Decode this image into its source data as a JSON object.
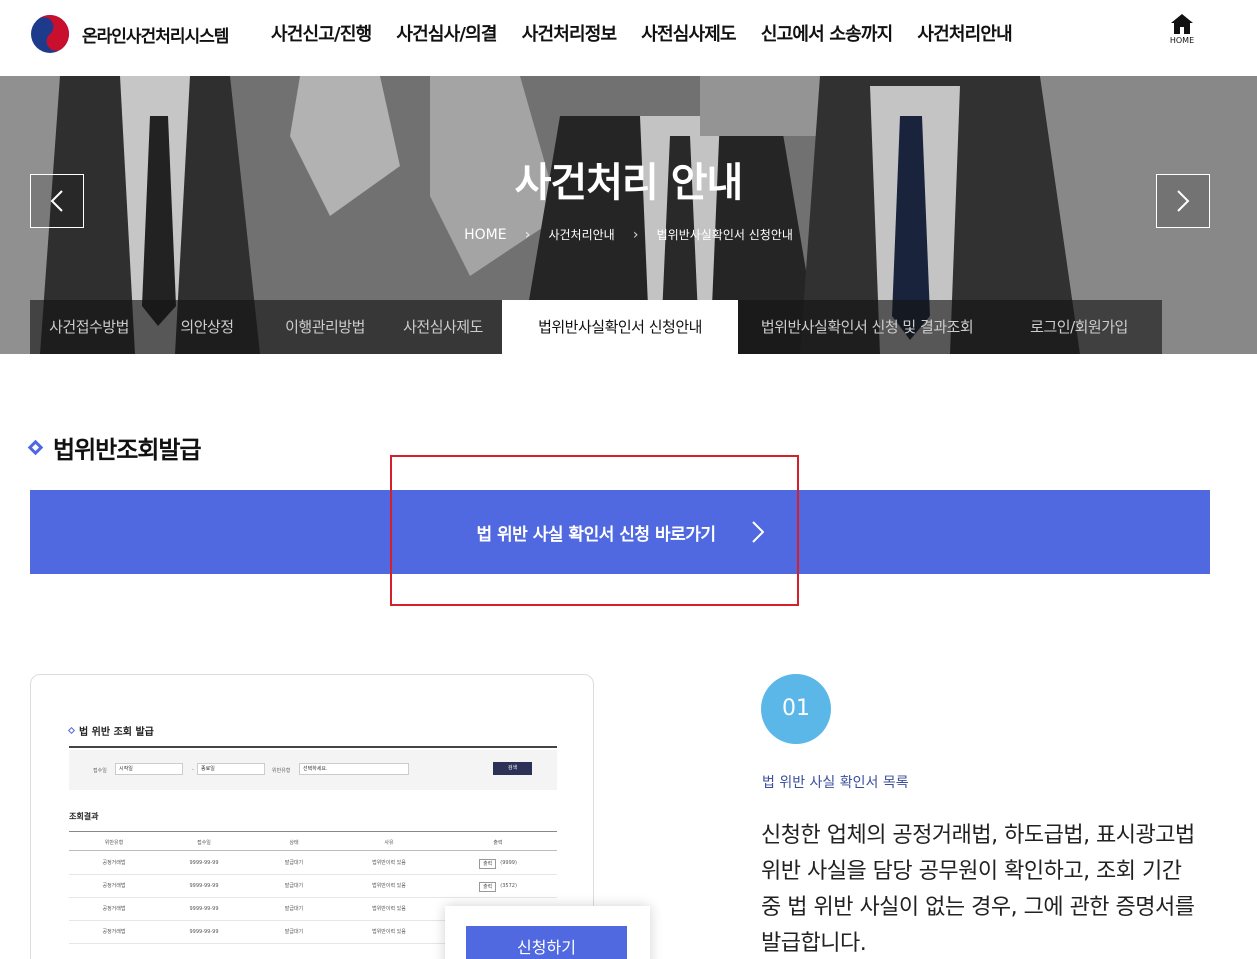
{
  "header": {
    "logo_text": "온라인사건처리시스템",
    "nav": [
      "사건신고/진행",
      "사건심사/의결",
      "사건처리정보",
      "사전심사제도",
      "신고에서 소송까지",
      "사건처리안내"
    ],
    "home_label": "HOME"
  },
  "hero": {
    "title": "사건처리 안내",
    "breadcrumb": [
      "HOME",
      "사건처리안내",
      "법위반사실확인서 신청안내"
    ]
  },
  "tabs": [
    {
      "label": "사건접수방법"
    },
    {
      "label": "의안상정"
    },
    {
      "label": "이행관리방법"
    },
    {
      "label": "사전심사제도"
    },
    {
      "label": "법위반사실확인서 신청안내"
    },
    {
      "label": "법위반사실확인서 신청 및 결과조회"
    },
    {
      "label": "로그인/회원가입"
    }
  ],
  "section": {
    "title": "법위반조회발급",
    "cta_label": "법 위반 사실 확인서 신청 바로가기"
  },
  "preview": {
    "title": "법 위반 조회 발급",
    "search": {
      "label_date": "접수일",
      "start_placeholder": "시작일",
      "sep": "-",
      "end_placeholder": "종료일",
      "label_type": "위반유형",
      "select_placeholder": "선택하세요.",
      "button": "검색"
    },
    "result_title": "조회결과",
    "columns": [
      "위반유형",
      "접수일",
      "상태",
      "사유",
      "출력"
    ],
    "rows": [
      {
        "type": "공정거래법",
        "date": "9999-99-99",
        "status": "발급대기",
        "reason": "법위반이력 있음",
        "print": "출력",
        "count": "(9999)"
      },
      {
        "type": "공정거래법",
        "date": "9999-99-99",
        "status": "발급대기",
        "reason": "법위반이력 있음",
        "print": "출력",
        "count": "(3572)"
      },
      {
        "type": "공정거래법",
        "date": "9999-99-99",
        "status": "발급대기",
        "reason": "법위반이력 있음",
        "print": "",
        "count": ""
      },
      {
        "type": "공정거래법",
        "date": "9999-99-99",
        "status": "발급대기",
        "reason": "법위반이력 있음",
        "print": "",
        "count": ""
      }
    ],
    "apply_button": "신청하기"
  },
  "step": {
    "number": "01",
    "label": "법 위반 사실 확인서 목록",
    "description": "신청한 업체의 공정거래법, 하도급법, 표시광고법 위반 사실을 담당 공무원이 확인하고, 조회 기간 중 법 위반 사실이 없는 경우, 그에 관한 증명서를 발급합니다."
  },
  "colors": {
    "accent": "#5068e0",
    "step_circle": "#5bb7e8",
    "highlight": "#d3202a"
  }
}
